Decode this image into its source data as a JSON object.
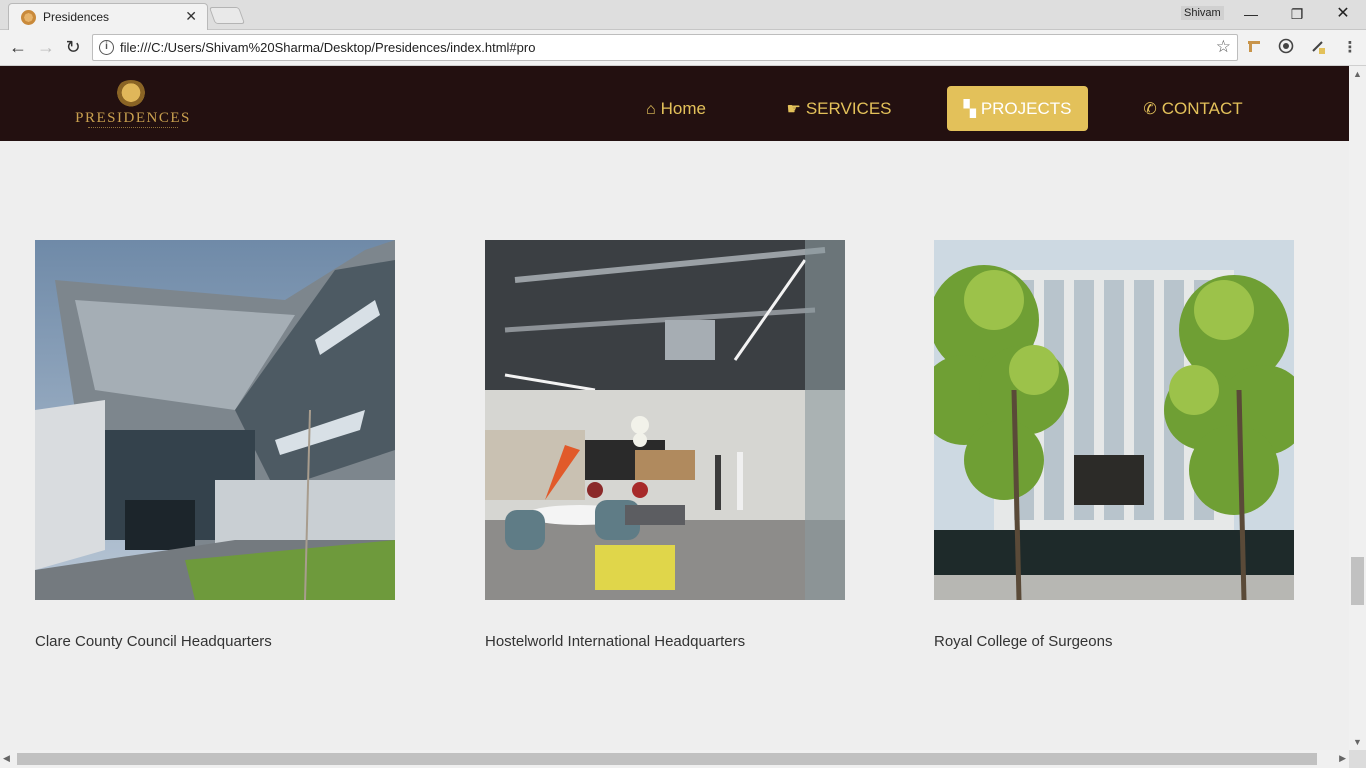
{
  "browser": {
    "tab_title": "Presidences",
    "tab_close": "✕",
    "profile_name": "Shivam",
    "window_min": "—",
    "window_max": "❐",
    "window_close": "✕",
    "url": "file:///C:/Users/Shivam%20Sharma/Desktop/Presidences/index.html#pro",
    "nav_back": "←",
    "nav_forward": "→",
    "nav_reload": "↻",
    "info_icon": "i",
    "star_icon": "☆",
    "menu_icon": "⋮"
  },
  "site": {
    "logo_text": "PRESIDENCES",
    "nav": [
      {
        "label": "Home",
        "icon": "home-icon",
        "glyph": "⌂"
      },
      {
        "label": "SERVICES",
        "icon": "handshake-icon",
        "glyph": "☛"
      },
      {
        "label": "PROJECTS",
        "icon": "sitemap-icon",
        "glyph": "▚",
        "active": true
      },
      {
        "label": "CONTACT",
        "icon": "phone-icon",
        "glyph": "✆"
      }
    ],
    "accent_color": "#e3c15a",
    "header_color": "#231010"
  },
  "projects": [
    {
      "title": "Clare County Council Headquarters"
    },
    {
      "title": "Hostelworld International Headquarters"
    },
    {
      "title": "Royal College of Surgeons"
    }
  ]
}
